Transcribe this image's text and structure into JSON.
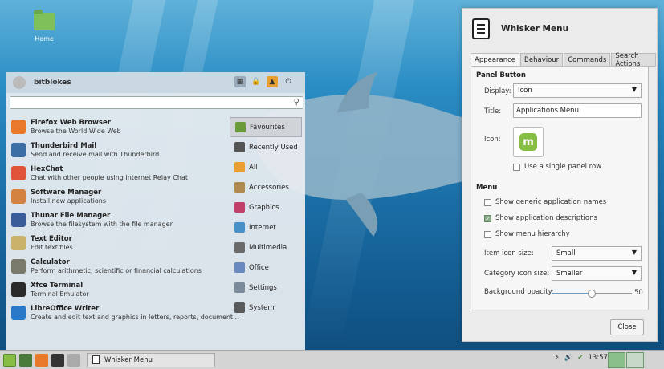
{
  "desktop": {
    "home_label": "Home"
  },
  "whisker": {
    "username": "bitblokes",
    "search_placeholder": "",
    "apps": [
      {
        "name": "Firefox Web Browser",
        "desc": "Browse the World Wide Web",
        "icon": "firefox-icon",
        "color": "#e8782a"
      },
      {
        "name": "Thunderbird Mail",
        "desc": "Send and receive mail with Thunderbird",
        "icon": "thunderbird-icon",
        "color": "#3b6ea5"
      },
      {
        "name": "HexChat",
        "desc": "Chat with other people using Internet Relay Chat",
        "icon": "hexchat-icon",
        "color": "#e0553a"
      },
      {
        "name": "Software Manager",
        "desc": "Install new applications",
        "icon": "software-manager-icon",
        "color": "#d4823f"
      },
      {
        "name": "Thunar File Manager",
        "desc": "Browse the filesystem with the file manager",
        "icon": "thunar-icon",
        "color": "#3a5c99"
      },
      {
        "name": "Text Editor",
        "desc": "Edit text files",
        "icon": "text-editor-icon",
        "color": "#c9b26a"
      },
      {
        "name": "Calculator",
        "desc": "Perform arithmetic, scientific or financial calculations",
        "icon": "calculator-icon",
        "color": "#7a7a6a"
      },
      {
        "name": "Xfce Terminal",
        "desc": "Terminal Emulator",
        "icon": "terminal-icon",
        "color": "#2a2a2a"
      },
      {
        "name": "LibreOffice Writer",
        "desc": "Create and edit text and graphics in letters, reports, document...",
        "icon": "writer-icon",
        "color": "#2a78c8"
      }
    ],
    "categories": [
      {
        "label": "Favourites",
        "icon": "favourites-icon",
        "color": "#6a9a3a"
      },
      {
        "label": "Recently Used",
        "icon": "recent-icon",
        "color": "#555555"
      },
      {
        "label": "All",
        "icon": "all-icon",
        "color": "#e8a030"
      },
      {
        "label": "Accessories",
        "icon": "accessories-icon",
        "color": "#b08a50"
      },
      {
        "label": "Graphics",
        "icon": "graphics-icon",
        "color": "#c0406a"
      },
      {
        "label": "Internet",
        "icon": "internet-icon",
        "color": "#4a90c8"
      },
      {
        "label": "Multimedia",
        "icon": "multimedia-icon",
        "color": "#6a6a6a"
      },
      {
        "label": "Office",
        "icon": "office-icon",
        "color": "#6a8abf"
      },
      {
        "label": "Settings",
        "icon": "settings-icon",
        "color": "#7a8a9a"
      },
      {
        "label": "System",
        "icon": "system-icon",
        "color": "#5a5a5a"
      }
    ]
  },
  "dialog": {
    "title": "Whisker Menu",
    "tabs": [
      "Appearance",
      "Behaviour",
      "Commands",
      "Search Actions"
    ],
    "panel_button": "Panel Button",
    "display_label": "Display:",
    "display_value": "Icon",
    "title_label": "Title:",
    "title_value": "Applications Menu",
    "icon_label": "Icon:",
    "single_row": "Use a single panel row",
    "menu_section": "Menu",
    "generic_names": "Show generic application names",
    "app_descriptions": "Show application descriptions",
    "menu_hierarchy": "Show menu hierarchy",
    "item_icon_label": "Item icon size:",
    "item_icon_value": "Small",
    "category_icon_label": "Category icon size:",
    "category_icon_value": "Smaller",
    "opacity_label": "Background opacity:",
    "opacity_value": "50",
    "close": "Close"
  },
  "panel": {
    "task_label": "Whisker Menu",
    "clock": "13:57"
  }
}
